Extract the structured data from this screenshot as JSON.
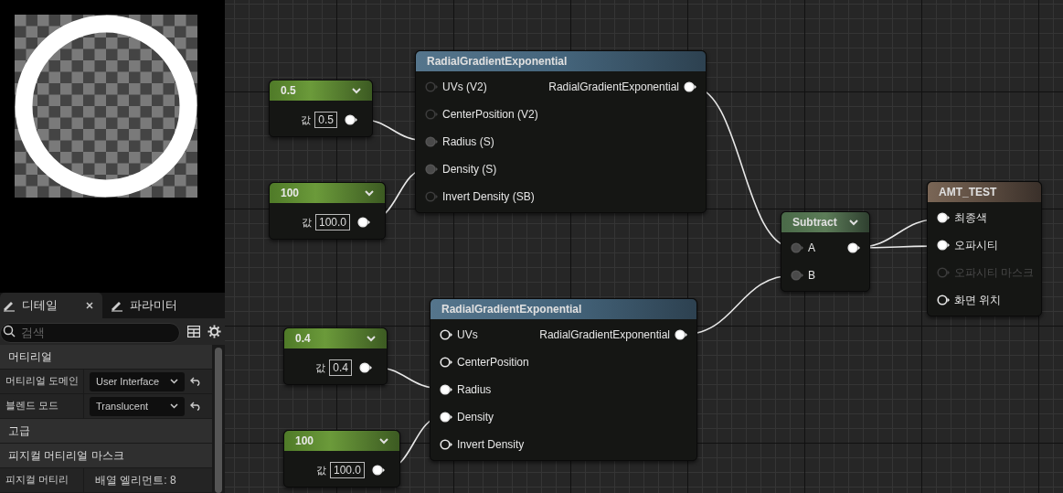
{
  "details_panel": {
    "tabs": [
      {
        "label": "디테일",
        "selected": true,
        "closable": true
      },
      {
        "label": "파라미터",
        "selected": false,
        "closable": false
      }
    ],
    "search": {
      "placeholder": "검색"
    },
    "rows": [
      {
        "kind": "category",
        "label": "머티리얼"
      },
      {
        "kind": "dropdown",
        "label": "머티리얼 도메인",
        "value": "User Interface"
      },
      {
        "kind": "dropdown",
        "label": "블렌드 모드",
        "value": "Translucent"
      },
      {
        "kind": "category",
        "label": "고급"
      },
      {
        "kind": "category",
        "label": "피지컬 머티리얼 마스크"
      },
      {
        "kind": "text",
        "label": "피지컬 머티리",
        "value": "배열 엘리먼트: 8"
      }
    ]
  },
  "graph": {
    "nodes": [
      {
        "kind": "constant",
        "title": "0.5",
        "label": "값",
        "value": "0.5"
      },
      {
        "kind": "constant",
        "title": "100",
        "label": "값",
        "value": "100.0"
      },
      {
        "kind": "function",
        "title": "RadialGradientExponential",
        "active": false,
        "inputs": [
          {
            "label": "UVs (V2)",
            "connected": false
          },
          {
            "label": "CenterPosition (V2)",
            "connected": false
          },
          {
            "label": "Radius (S)",
            "connected": true
          },
          {
            "label": "Density (S)",
            "connected": true
          },
          {
            "label": "Invert Density (SB)",
            "connected": false
          }
        ],
        "output": {
          "label": "RadialGradientExponential"
        }
      },
      {
        "kind": "constant",
        "title": "0.4",
        "label": "값",
        "value": "0.4"
      },
      {
        "kind": "constant",
        "title": "100",
        "label": "값",
        "value": "100.0"
      },
      {
        "kind": "function",
        "title": "RadialGradientExponential",
        "active": true,
        "inputs": [
          {
            "label": "UVs",
            "connected": false
          },
          {
            "label": "CenterPosition",
            "connected": false
          },
          {
            "label": "Radius",
            "connected": true
          },
          {
            "label": "Density",
            "connected": true
          },
          {
            "label": "Invert Density",
            "connected": false
          }
        ],
        "output": {
          "label": "RadialGradientExponential"
        }
      },
      {
        "kind": "operator",
        "title": "Subtract",
        "active": false,
        "inputs": [
          {
            "label": "A",
            "connected": true
          },
          {
            "label": "B",
            "connected": true
          }
        ]
      },
      {
        "kind": "result",
        "title": "AMT_TEST",
        "active": true,
        "inputs": [
          {
            "label": "최종색",
            "connected": true,
            "disabled": false
          },
          {
            "label": "오파시티",
            "connected": true,
            "disabled": false
          },
          {
            "label": "오파시티 마스크",
            "connected": false,
            "disabled": true
          },
          {
            "label": "화면 위치",
            "connected": false,
            "disabled": false
          }
        ]
      }
    ]
  }
}
